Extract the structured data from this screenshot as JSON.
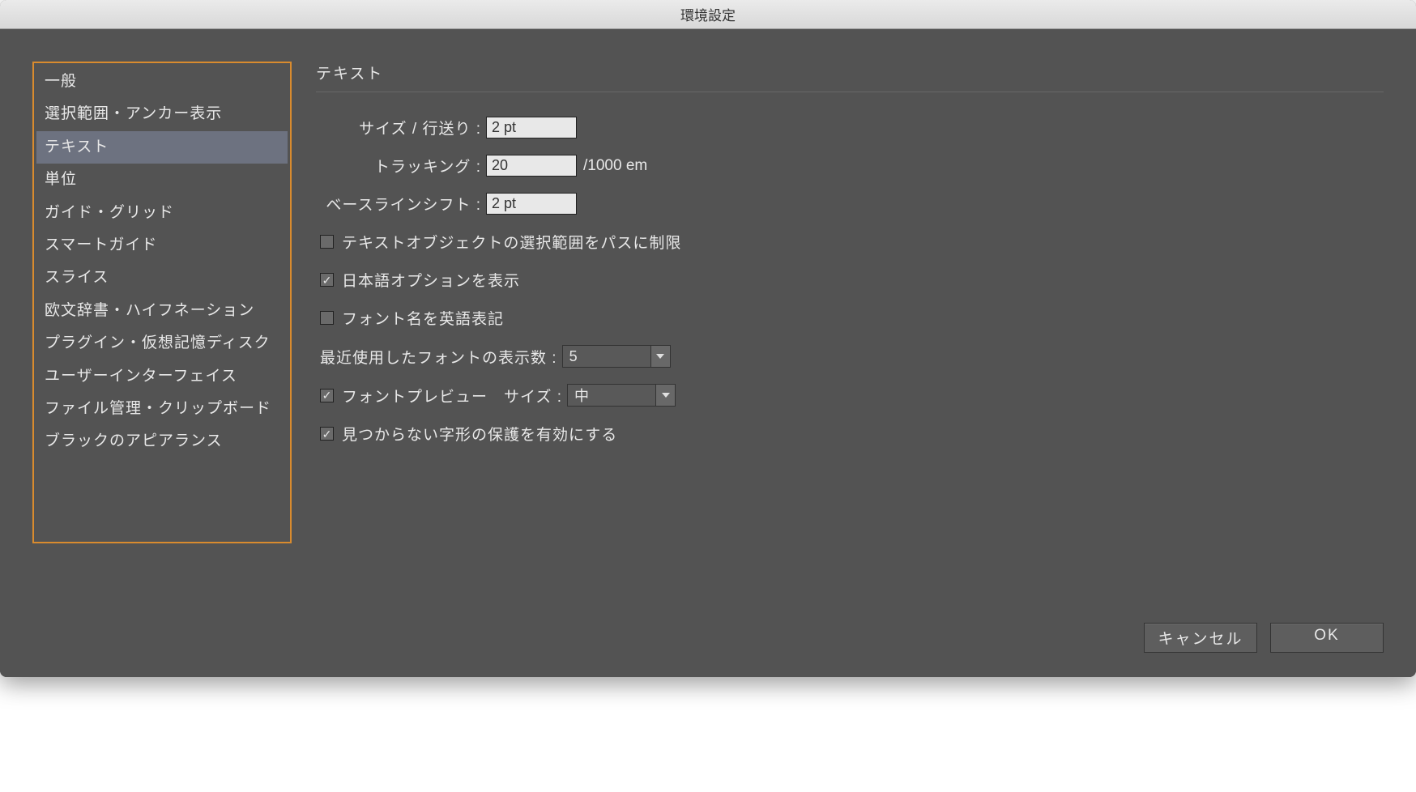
{
  "dialog": {
    "title": "環境設定"
  },
  "sidebar": {
    "items": [
      {
        "label": "一般",
        "selected": false
      },
      {
        "label": "選択範囲・アンカー表示",
        "selected": false
      },
      {
        "label": "テキスト",
        "selected": true
      },
      {
        "label": "単位",
        "selected": false
      },
      {
        "label": "ガイド・グリッド",
        "selected": false
      },
      {
        "label": "スマートガイド",
        "selected": false
      },
      {
        "label": "スライス",
        "selected": false
      },
      {
        "label": "欧文辞書・ハイフネーション",
        "selected": false
      },
      {
        "label": "プラグイン・仮想記憶ディスク",
        "selected": false
      },
      {
        "label": "ユーザーインターフェイス",
        "selected": false
      },
      {
        "label": "ファイル管理・クリップボード",
        "selected": false
      },
      {
        "label": "ブラックのアピアランス",
        "selected": false
      }
    ]
  },
  "panel": {
    "title": "テキスト",
    "size_leading_label": "サイズ / 行送り :",
    "size_leading_value": "2 pt",
    "tracking_label": "トラッキング :",
    "tracking_value": "20",
    "tracking_suffix": "/1000 em",
    "baseline_label": "ベースラインシフト :",
    "baseline_value": "2 pt",
    "cb_path_limit_label": "テキストオブジェクトの選択範囲をパスに制限",
    "cb_path_limit_checked": false,
    "cb_jp_options_label": "日本語オプションを表示",
    "cb_jp_options_checked": true,
    "cb_english_font_label": "フォント名を英語表記",
    "cb_english_font_checked": false,
    "recent_fonts_label": "最近使用したフォントの表示数 :",
    "recent_fonts_value": "5",
    "cb_font_preview_label": "フォントプレビュー",
    "cb_font_preview_checked": true,
    "preview_size_label": "サイズ :",
    "preview_size_value": "中",
    "cb_missing_glyph_label": "見つからない字形の保護を有効にする",
    "cb_missing_glyph_checked": true
  },
  "buttons": {
    "cancel": "キャンセル",
    "ok": "OK"
  }
}
